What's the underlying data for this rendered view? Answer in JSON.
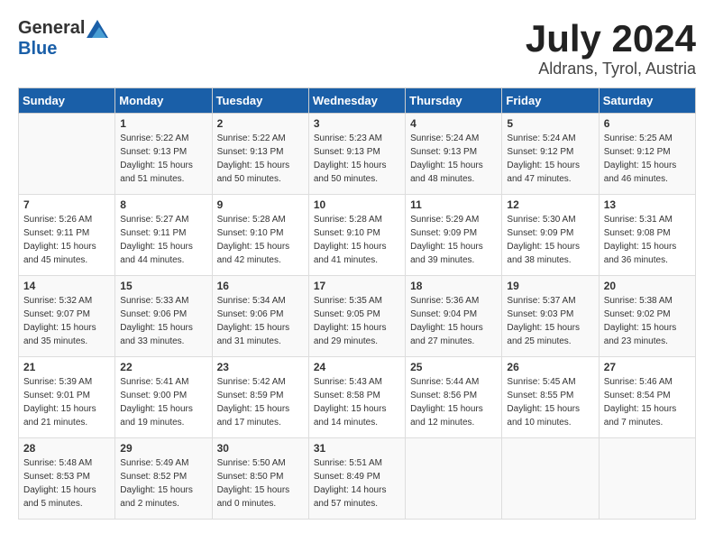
{
  "header": {
    "logo_general": "General",
    "logo_blue": "Blue",
    "title": "July 2024",
    "location": "Aldrans, Tyrol, Austria"
  },
  "calendar": {
    "days_of_week": [
      "Sunday",
      "Monday",
      "Tuesday",
      "Wednesday",
      "Thursday",
      "Friday",
      "Saturday"
    ],
    "weeks": [
      [
        {
          "day": "",
          "info": ""
        },
        {
          "day": "1",
          "info": "Sunrise: 5:22 AM\nSunset: 9:13 PM\nDaylight: 15 hours\nand 51 minutes."
        },
        {
          "day": "2",
          "info": "Sunrise: 5:22 AM\nSunset: 9:13 PM\nDaylight: 15 hours\nand 50 minutes."
        },
        {
          "day": "3",
          "info": "Sunrise: 5:23 AM\nSunset: 9:13 PM\nDaylight: 15 hours\nand 50 minutes."
        },
        {
          "day": "4",
          "info": "Sunrise: 5:24 AM\nSunset: 9:13 PM\nDaylight: 15 hours\nand 48 minutes."
        },
        {
          "day": "5",
          "info": "Sunrise: 5:24 AM\nSunset: 9:12 PM\nDaylight: 15 hours\nand 47 minutes."
        },
        {
          "day": "6",
          "info": "Sunrise: 5:25 AM\nSunset: 9:12 PM\nDaylight: 15 hours\nand 46 minutes."
        }
      ],
      [
        {
          "day": "7",
          "info": "Sunrise: 5:26 AM\nSunset: 9:11 PM\nDaylight: 15 hours\nand 45 minutes."
        },
        {
          "day": "8",
          "info": "Sunrise: 5:27 AM\nSunset: 9:11 PM\nDaylight: 15 hours\nand 44 minutes."
        },
        {
          "day": "9",
          "info": "Sunrise: 5:28 AM\nSunset: 9:10 PM\nDaylight: 15 hours\nand 42 minutes."
        },
        {
          "day": "10",
          "info": "Sunrise: 5:28 AM\nSunset: 9:10 PM\nDaylight: 15 hours\nand 41 minutes."
        },
        {
          "day": "11",
          "info": "Sunrise: 5:29 AM\nSunset: 9:09 PM\nDaylight: 15 hours\nand 39 minutes."
        },
        {
          "day": "12",
          "info": "Sunrise: 5:30 AM\nSunset: 9:09 PM\nDaylight: 15 hours\nand 38 minutes."
        },
        {
          "day": "13",
          "info": "Sunrise: 5:31 AM\nSunset: 9:08 PM\nDaylight: 15 hours\nand 36 minutes."
        }
      ],
      [
        {
          "day": "14",
          "info": "Sunrise: 5:32 AM\nSunset: 9:07 PM\nDaylight: 15 hours\nand 35 minutes."
        },
        {
          "day": "15",
          "info": "Sunrise: 5:33 AM\nSunset: 9:06 PM\nDaylight: 15 hours\nand 33 minutes."
        },
        {
          "day": "16",
          "info": "Sunrise: 5:34 AM\nSunset: 9:06 PM\nDaylight: 15 hours\nand 31 minutes."
        },
        {
          "day": "17",
          "info": "Sunrise: 5:35 AM\nSunset: 9:05 PM\nDaylight: 15 hours\nand 29 minutes."
        },
        {
          "day": "18",
          "info": "Sunrise: 5:36 AM\nSunset: 9:04 PM\nDaylight: 15 hours\nand 27 minutes."
        },
        {
          "day": "19",
          "info": "Sunrise: 5:37 AM\nSunset: 9:03 PM\nDaylight: 15 hours\nand 25 minutes."
        },
        {
          "day": "20",
          "info": "Sunrise: 5:38 AM\nSunset: 9:02 PM\nDaylight: 15 hours\nand 23 minutes."
        }
      ],
      [
        {
          "day": "21",
          "info": "Sunrise: 5:39 AM\nSunset: 9:01 PM\nDaylight: 15 hours\nand 21 minutes."
        },
        {
          "day": "22",
          "info": "Sunrise: 5:41 AM\nSunset: 9:00 PM\nDaylight: 15 hours\nand 19 minutes."
        },
        {
          "day": "23",
          "info": "Sunrise: 5:42 AM\nSunset: 8:59 PM\nDaylight: 15 hours\nand 17 minutes."
        },
        {
          "day": "24",
          "info": "Sunrise: 5:43 AM\nSunset: 8:58 PM\nDaylight: 15 hours\nand 14 minutes."
        },
        {
          "day": "25",
          "info": "Sunrise: 5:44 AM\nSunset: 8:56 PM\nDaylight: 15 hours\nand 12 minutes."
        },
        {
          "day": "26",
          "info": "Sunrise: 5:45 AM\nSunset: 8:55 PM\nDaylight: 15 hours\nand 10 minutes."
        },
        {
          "day": "27",
          "info": "Sunrise: 5:46 AM\nSunset: 8:54 PM\nDaylight: 15 hours\nand 7 minutes."
        }
      ],
      [
        {
          "day": "28",
          "info": "Sunrise: 5:48 AM\nSunset: 8:53 PM\nDaylight: 15 hours\nand 5 minutes."
        },
        {
          "day": "29",
          "info": "Sunrise: 5:49 AM\nSunset: 8:52 PM\nDaylight: 15 hours\nand 2 minutes."
        },
        {
          "day": "30",
          "info": "Sunrise: 5:50 AM\nSunset: 8:50 PM\nDaylight: 15 hours\nand 0 minutes."
        },
        {
          "day": "31",
          "info": "Sunrise: 5:51 AM\nSunset: 8:49 PM\nDaylight: 14 hours\nand 57 minutes."
        },
        {
          "day": "",
          "info": ""
        },
        {
          "day": "",
          "info": ""
        },
        {
          "day": "",
          "info": ""
        }
      ]
    ]
  }
}
